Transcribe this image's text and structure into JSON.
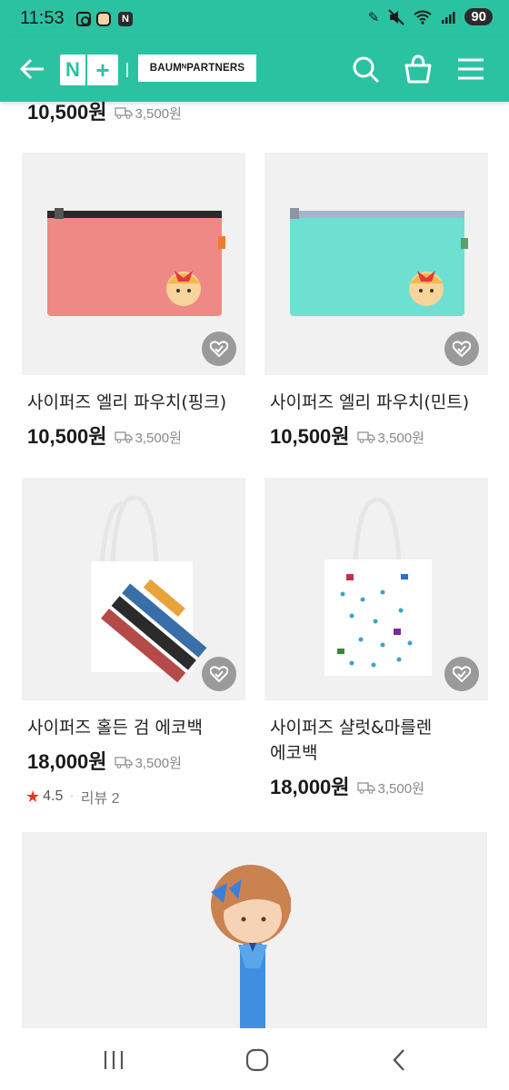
{
  "status_bar": {
    "time": "11:53",
    "n_badge": "N",
    "battery": "90",
    "icons": [
      "instagram-icon",
      "avatar-icon",
      "n-app-icon",
      "edit-icon",
      "mute-icon",
      "wifi-icon",
      "signal-icon",
      "battery-icon"
    ]
  },
  "header": {
    "logo_n": "N",
    "logo_plus": "+",
    "brand": "BAUMᴺPARTNERS",
    "icons": [
      "back-arrow-icon",
      "search-icon",
      "shopping-bag-icon",
      "menu-icon"
    ]
  },
  "top_row": {
    "price": "10,500원",
    "shipping": "3,500원"
  },
  "products": [
    {
      "title": "사이퍼즈 엘리 파우치(핑크)",
      "price": "10,500원",
      "shipping": "3,500원",
      "image": "pink-pouch",
      "color": "#ef8986"
    },
    {
      "title": "사이퍼즈 엘리 파우치(민트)",
      "price": "10,500원",
      "shipping": "3,500원",
      "image": "mint-pouch",
      "color": "#6ee0d2"
    },
    {
      "title": "사이퍼즈 홀든 검 에코백",
      "price": "18,000원",
      "shipping": "3,500원",
      "rating": "4.5",
      "review": "리뷰 2",
      "image": "sword-ecobag"
    },
    {
      "title_line1": "사이퍼즈 샬럿&마를렌",
      "title_line2": "에코백",
      "price": "18,000원",
      "shipping": "3,500원",
      "image": "rain-ecobag"
    }
  ],
  "colors": {
    "accent": "#2bc2a2",
    "price_text": "#1a1a1a",
    "star": "#e8391e",
    "card_bg": "#f1f1f1"
  },
  "nav_bar": {
    "icons": [
      "recent-apps-icon",
      "home-icon",
      "back-icon"
    ]
  }
}
